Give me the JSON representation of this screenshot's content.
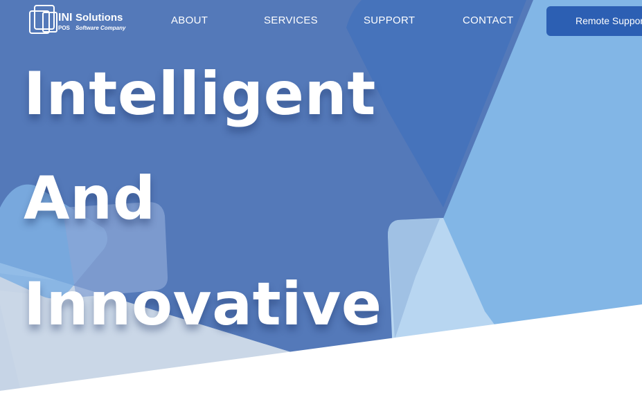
{
  "brand": {
    "logo_ini": "INI",
    "logo_pos": "POS",
    "logo_solutions": "Solutions",
    "logo_tagline": "Software Company"
  },
  "nav": {
    "items": [
      {
        "label": "ABOUT"
      },
      {
        "label": "SERVICES"
      },
      {
        "label": "SUPPORT"
      },
      {
        "label": "CONTACT"
      }
    ],
    "cta_label": "Remote Support"
  },
  "hero": {
    "lines": [
      "Intelligent",
      "And",
      "Innovative"
    ]
  },
  "colors": {
    "primary_blue": "#5479b9",
    "accent_blue": "#2c5fb3",
    "light_blue": "#82b6e6",
    "pale_blue": "#b8d6f1",
    "text_white": "#ffffff"
  }
}
